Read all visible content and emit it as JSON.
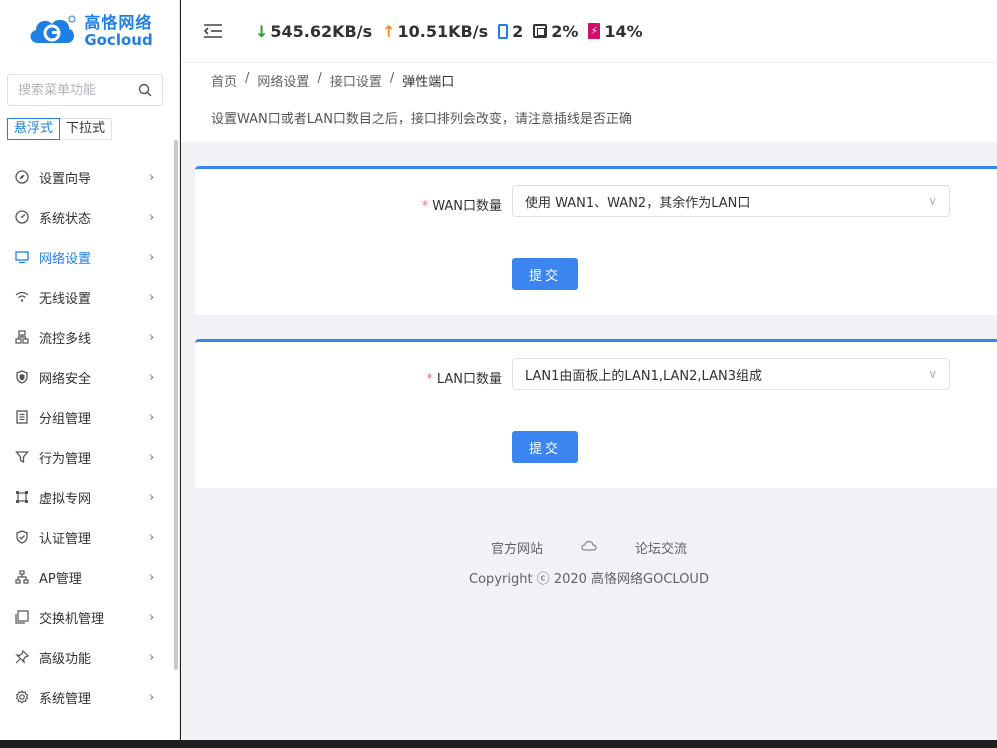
{
  "logo": {
    "cn": "高恪网络",
    "en": "Gocloud"
  },
  "search": {
    "placeholder": "搜索菜单功能"
  },
  "menu_modes": [
    "悬浮式",
    "下拉式"
  ],
  "menu": [
    {
      "label": "设置向导",
      "icon": "compass-icon"
    },
    {
      "label": "系统状态",
      "icon": "dashboard-icon"
    },
    {
      "label": "网络设置",
      "icon": "monitor-icon",
      "active": true
    },
    {
      "label": "无线设置",
      "icon": "wifi-icon"
    },
    {
      "label": "流控多线",
      "icon": "network-icon"
    },
    {
      "label": "网络安全",
      "icon": "shield-icon"
    },
    {
      "label": "分组管理",
      "icon": "group-icon"
    },
    {
      "label": "行为管理",
      "icon": "filter-icon"
    },
    {
      "label": "虚拟专网",
      "icon": "vpn-icon"
    },
    {
      "label": "认证管理",
      "icon": "shield-check-icon"
    },
    {
      "label": "AP管理",
      "icon": "topology-icon"
    },
    {
      "label": "交换机管理",
      "icon": "switch-icon"
    },
    {
      "label": "高级功能",
      "icon": "pin-icon"
    },
    {
      "label": "系统管理",
      "icon": "gear-icon"
    }
  ],
  "header": {
    "download": "545.62KB/s",
    "upload": "10.51KB/s",
    "devices": "2",
    "cpu": "2%",
    "memory": "14%"
  },
  "breadcrumb": [
    "首页",
    "网络设置",
    "接口设置",
    "弹性端口"
  ],
  "notice": "设置WAN口或者LAN口数目之后，接口排列会改变，请注意插线是否正确",
  "wan": {
    "label": "WAN口数量",
    "value": "使用 WAN1、WAN2，其余作为LAN口",
    "submit": "提交"
  },
  "lan": {
    "label": "LAN口数量",
    "value": "LAN1由面板上的LAN1,LAN2,LAN3组成",
    "submit": "提交"
  },
  "footer": {
    "official_site": "官方网站",
    "forum": "论坛交流",
    "copyright": "Copyright ⓒ 2020 高恪网络GOCLOUD"
  }
}
